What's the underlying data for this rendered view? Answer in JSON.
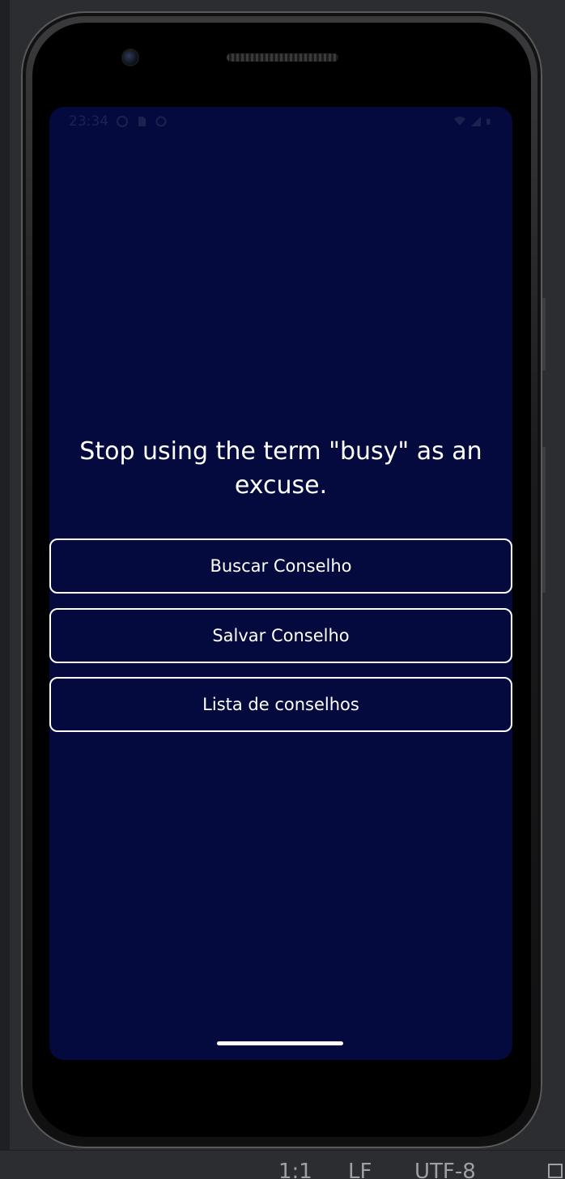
{
  "status_bar": {
    "time": "23:34"
  },
  "advice": {
    "text": "Stop using the term \"busy\" as an excuse."
  },
  "buttons": {
    "fetch_label": "Buscar Conselho",
    "save_label": "Salvar Conselho",
    "list_label": "Lista de conselhos"
  },
  "ide_status": {
    "position": "1:1",
    "line_separator": "LF",
    "encoding": "UTF-8"
  },
  "colors": {
    "screen_background": "#040a3e",
    "button_border": "#ffffff",
    "text": "#ffffff"
  }
}
